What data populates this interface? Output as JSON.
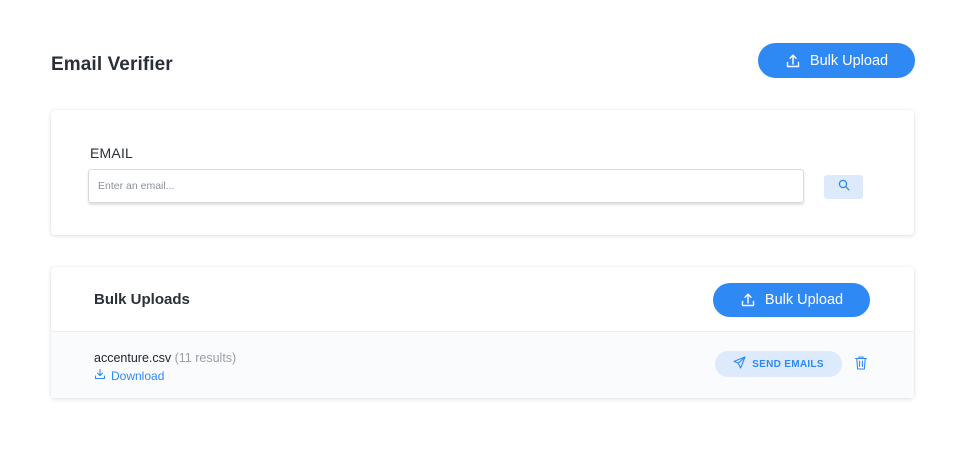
{
  "header": {
    "title": "Email Verifier",
    "bulk_upload_label": "Bulk Upload",
    "upload_icon": "upload-icon"
  },
  "email_card": {
    "label": "EMAIL",
    "input_placeholder": "Enter an email...",
    "input_value": "",
    "search_icon": "search-icon"
  },
  "bulk_uploads": {
    "title": "Bulk Uploads",
    "bulk_upload_label": "Bulk Upload",
    "rows": [
      {
        "file_name": "accenture.csv",
        "results": "(11 results)",
        "download_label": "Download",
        "send_label": "SEND EMAILS",
        "send_icon": "paper-plane-icon",
        "delete_icon": "trash-icon"
      }
    ]
  },
  "colors": {
    "accent": "#2f89f5",
    "accent_light": "#ddeafc",
    "text": "#2b2f38",
    "muted": "#9a9fa7"
  }
}
